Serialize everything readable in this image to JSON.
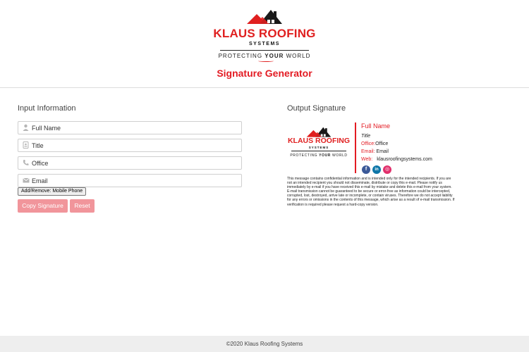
{
  "brand": {
    "name": "KLAUS ROOFING",
    "systems": "SYSTEMS",
    "tagline_pre": "PROTECTING ",
    "tagline_em": "YOUR",
    "tagline_post": " WORLD",
    "accent_color": "#e31b23"
  },
  "header": {
    "title": "Signature Generator"
  },
  "input_section": {
    "heading": "Input Information",
    "fields": [
      {
        "icon": "user-icon",
        "value": "Full Name"
      },
      {
        "icon": "id-badge-icon",
        "value": "Title"
      },
      {
        "icon": "phone-icon",
        "value": "Office"
      },
      {
        "icon": "envelope-icon",
        "value": "Email"
      }
    ],
    "toggle_label": "Add/Remove: Mobile Phone",
    "copy_label": "Copy Signature",
    "reset_label": "Reset"
  },
  "output_section": {
    "heading": "Output Signature",
    "name": "Full Name",
    "title": "Title",
    "office_label": "Office:",
    "office_value": "Office",
    "email_label": "Email:",
    "email_value": "Email",
    "web_label": "Web:",
    "web_value": "klausroofingsystems.com",
    "social": [
      {
        "icon": "facebook-icon",
        "glyph": "f"
      },
      {
        "icon": "linkedin-icon",
        "glyph": "in"
      },
      {
        "icon": "instagram-icon",
        "glyph": "◎"
      }
    ],
    "disclaimer": "This message contains confidential information and is intended only for the intended recipients. If you are not an intended recipient you should not disseminate, distribute or copy this e-mail. Please notify us immediately by e-mail if you have received this e-mail by mistake and delete this e-mail from your system. E-mail transmission cannot be guaranteed to be secure or error-free as information could be intercepted, corrupted, lost, destroyed, arrive late or incomplete, or contain viruses. Therefore we do not accept liability for any errors or omissions in the contents of this message, which arise as a result of e-mail transmission. If verification is required please request a hard-copy version."
  },
  "footer": {
    "text": "©2020 Klaus Roofing Systems"
  }
}
